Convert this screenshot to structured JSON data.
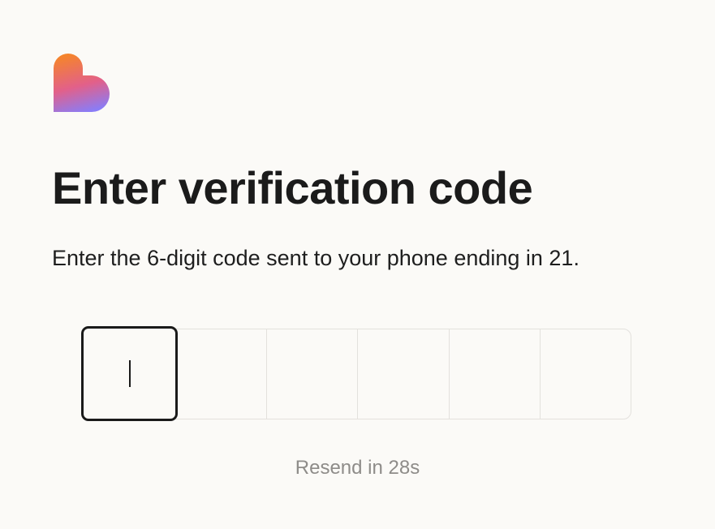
{
  "brand": {
    "logo_icon": "heart-logo-icon",
    "gradient_colors": [
      "#f5842c",
      "#e15c8a",
      "#8a7cf6"
    ]
  },
  "header": {
    "title": "Enter verification code",
    "subtitle": "Enter the 6-digit code sent to your phone ending in 21."
  },
  "otp": {
    "digit_count": 6,
    "values": [
      "",
      "",
      "",
      "",
      "",
      ""
    ],
    "active_index": 0
  },
  "footer": {
    "resend_text": "Resend in 28s"
  },
  "colors": {
    "background": "#fbfaf7",
    "text": "#1b1b1b",
    "muted": "#8e8c89",
    "border": "#e3e1dd",
    "active_border": "#1a1a1a"
  }
}
